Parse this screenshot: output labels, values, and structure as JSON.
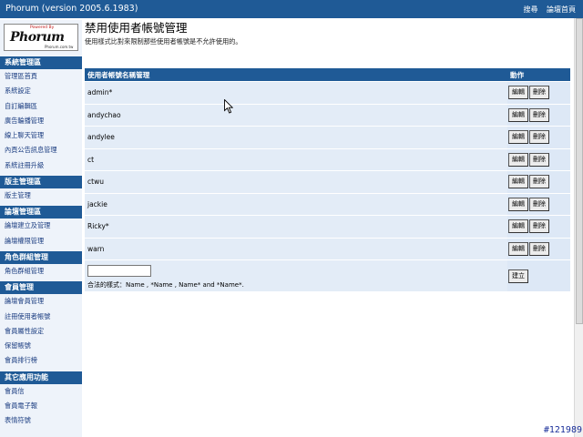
{
  "topbar": {
    "title": "Phorum (version 2005.6.1983)",
    "links": [
      "搜尋",
      "論壇首頁"
    ]
  },
  "logo": {
    "powered": "Powered By",
    "name": "Phorum",
    "sub": "Phorum.com.tw"
  },
  "sidebar": {
    "sections": [
      {
        "title": "系統管理區",
        "items": [
          "管理區首頁",
          "系統設定",
          "自訂編輯區",
          "廣告輪播管理",
          "線上聊天管理",
          "內頁公告訊息管理",
          "系統註冊升級"
        ]
      },
      {
        "title": "版主管理區",
        "items": [
          "版主管理"
        ]
      },
      {
        "title": "論壇管理區",
        "items": [
          "論壇建立及管理",
          "論壇權限管理"
        ]
      },
      {
        "title": "角色群組管理",
        "items": [
          "角色群組管理"
        ]
      },
      {
        "title": "會員管理",
        "items": [
          "論壇會員管理",
          "註冊使用者帳號",
          "會員屬性設定",
          "保留帳號",
          "會員排行榜"
        ]
      },
      {
        "title": "其它應用功能",
        "items": [
          "會員信",
          "會員電子報",
          "表情符號"
        ]
      }
    ]
  },
  "main": {
    "title": "禁用使用者帳號管理",
    "description": "使用樣式比對來限制那些使用者帳號是不允許使用的。",
    "table": {
      "col_name": "使用者帳號名稱管理",
      "col_action": "動作",
      "edit_label": "編輯",
      "delete_label": "刪除",
      "rows": [
        "admin*",
        "andychao",
        "andylee",
        "ct",
        "ctwu",
        "jackie",
        "Ricky*",
        "warn"
      ],
      "new_input_value": "",
      "hint": "合法的樣式：Name , *Name , Name* and *Name*.",
      "create_label": "建立"
    }
  },
  "corner_tag": "#121989"
}
